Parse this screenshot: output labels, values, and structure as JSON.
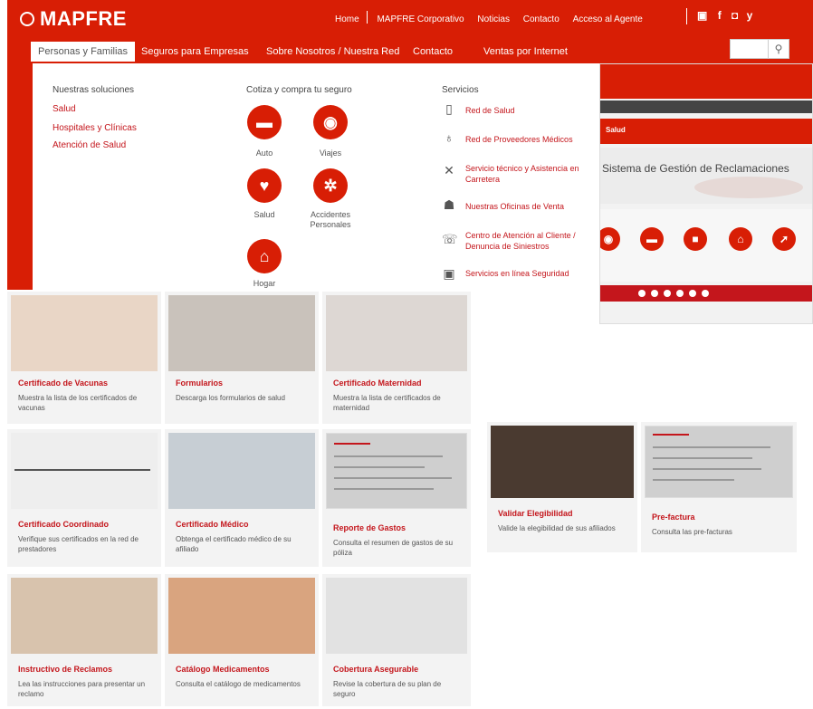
{
  "brand": {
    "logo": "MAPFRE",
    "accent": "#d81e05"
  },
  "topnav": [
    "Home",
    "MAPFRE Corporativo",
    "Noticias",
    "Contacto",
    "Acceso al Agente"
  ],
  "social_icons": [
    "youtube-icon",
    "facebook-icon",
    "googleplus-icon",
    "twitter-icon"
  ],
  "tabs": [
    "Personas y Familias",
    "Seguros para Empresas",
    "Sobre Nosotros / Nuestra Red",
    "Contacto",
    "Ventas por Internet"
  ],
  "search": {
    "icon": "search-icon"
  },
  "dropdown": {
    "col1_head": "Nuestras soluciones",
    "col1_links": [
      "Salud",
      "Hospitales y Clínicas",
      "Atención de Salud"
    ],
    "col2_head": "Cotiza y compra tu seguro",
    "products": [
      "Auto",
      "Viajes",
      "Salud",
      "Accidentes Personales",
      "Hogar"
    ],
    "col3_head": "Servicios",
    "services": [
      "Red de Salud",
      "Red de Proveedores Médicos",
      "Servicio técnico y Asistencia en Carretera",
      "Nuestras Oficinas de Venta",
      "Centro de Atención al Cliente / Denuncia de Siniestros",
      "Servicios en línea Seguridad"
    ]
  },
  "embedded": {
    "header_text": "Salud",
    "title": "Sistema de Gestión de Reclamaciones"
  },
  "cards": [
    {
      "title": "Certificado de Vacunas",
      "desc": "Muestra la lista de los certificados de vacunas"
    },
    {
      "title": "Formularios",
      "desc": "Descarga los formularios de salud"
    },
    {
      "title": "Certificado Maternidad",
      "desc": "Muestra la lista de certificados de maternidad"
    },
    {
      "title": "Certificado Coordinado",
      "desc": "Verifique sus certificados en la red de prestadores"
    },
    {
      "title": "Certificado Médico",
      "desc": "Obtenga el certificado médico de su afiliado"
    },
    {
      "title": "Reporte de Gastos",
      "desc": "Consulta el resumen de gastos de su póliza"
    },
    {
      "title": "Validar Elegibilidad",
      "desc": "Valide la elegibilidad de sus afiliados"
    },
    {
      "title": "Pre-factura",
      "desc": "Consulta las pre-facturas"
    },
    {
      "title": "Instructivo de Reclamos",
      "desc": "Lea las instrucciones para presentar un reclamo"
    },
    {
      "title": "Catálogo Medicamentos",
      "desc": "Consulta el catálogo de medicamentos"
    },
    {
      "title": "Cobertura Asegurable",
      "desc": "Revise la cobertura de su plan de seguro"
    }
  ]
}
